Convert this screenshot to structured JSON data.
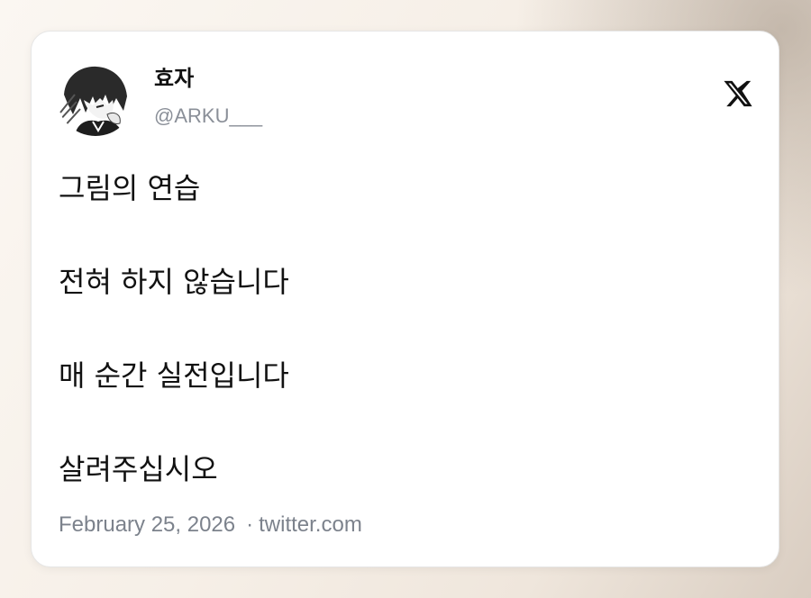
{
  "tweet": {
    "author_name": "효자",
    "author_handle": "@ARKU___",
    "lines": [
      "그림의 연습",
      "전혀 하지 않습니다",
      "매 순간 실전입니다",
      "살려주십시오"
    ],
    "date": "February 25, 2026",
    "separator": "·",
    "source": "twitter.com"
  },
  "icons": {
    "avatar": "manga-character-avatar",
    "platform": "x-logo-icon"
  },
  "colors": {
    "text": "#111111",
    "muted": "#7c828c",
    "card": "#ffffff"
  }
}
